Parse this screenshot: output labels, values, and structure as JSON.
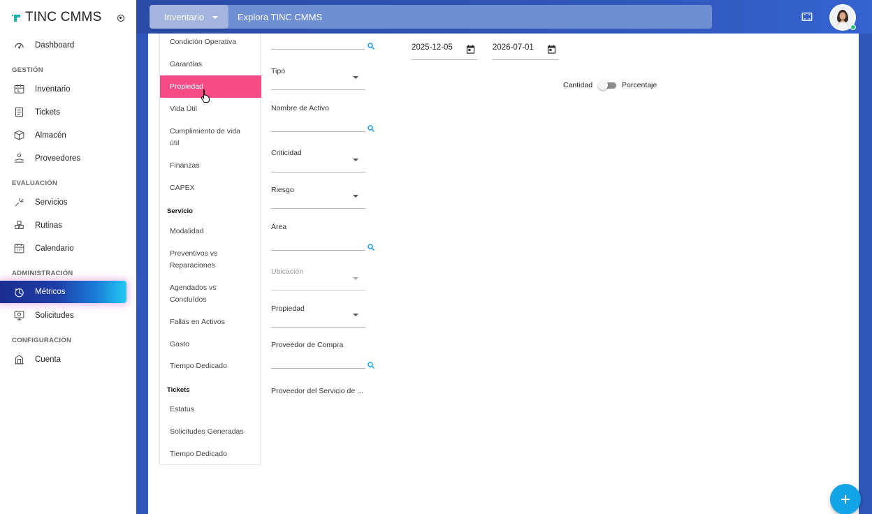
{
  "brand": {
    "title": "TINC CMMS"
  },
  "sidebar": {
    "items": [
      {
        "label": "Dashboard",
        "icon": "gauge-icon"
      },
      {
        "section": "GESTIÓN"
      },
      {
        "label": "Inventario",
        "icon": "inventory-icon"
      },
      {
        "label": "Tickets",
        "icon": "tickets-icon"
      },
      {
        "label": "Almacén",
        "icon": "box-icon"
      },
      {
        "label": "Proveedores",
        "icon": "supplier-icon"
      },
      {
        "section": "EVALUACIÓN"
      },
      {
        "label": "Servicios",
        "icon": "wrench-icon"
      },
      {
        "label": "Rutinas",
        "icon": "boxes-icon"
      },
      {
        "label": "Calendario",
        "icon": "calendar-icon"
      },
      {
        "section": "ADMINISTRACIÓN"
      },
      {
        "label": "Métricos",
        "icon": "metrics-icon",
        "active": true
      },
      {
        "label": "Solicitudes",
        "icon": "requests-icon"
      },
      {
        "section": "CONFIGURACIÓN"
      },
      {
        "label": "Cuenta",
        "icon": "account-icon"
      }
    ]
  },
  "topbar": {
    "module": "Inventario",
    "search_text": "Explora TINC CMMS"
  },
  "report_menu": {
    "items": [
      "Condición Operativa",
      "Garantías",
      "Propiedad",
      "Vida Útil",
      "Cumplimiento de vida útil",
      "Finanzas",
      "CAPEX"
    ],
    "active": "Propiedad",
    "service_header": "Servicio",
    "service_items": [
      "Modalidad",
      "Preventivos vs Reparaciones",
      "Agendados vs Concluídos",
      "Fallas en Activos",
      "Gasto",
      "Tiempo Dedicado"
    ],
    "tickets_header": "Tickets",
    "tickets_items": [
      "Estatus",
      "Solicitudes Generadas",
      "Tiempo Dedicado"
    ]
  },
  "filters": {
    "tipo": "Tipo",
    "nombre_activo": "Nombre de Activo",
    "criticidad": "Criticidad",
    "riesgo": "Riesgo",
    "area": "Área",
    "ubicacion": "Ubicación",
    "propiedad": "Propiedad",
    "proveedor_compra": "Proveedor de Compra",
    "proveedor_servicio": "Proveedor del Servicio de ..."
  },
  "dates": {
    "start": "2025-12-05",
    "end": "2026-07-01"
  },
  "toggle": {
    "left_label": "Cantidad",
    "right_label": "Porcentaje"
  },
  "colors": {
    "accent": "#f74b86",
    "topbar": "#2f56b9",
    "fab": "#12a4e6"
  }
}
